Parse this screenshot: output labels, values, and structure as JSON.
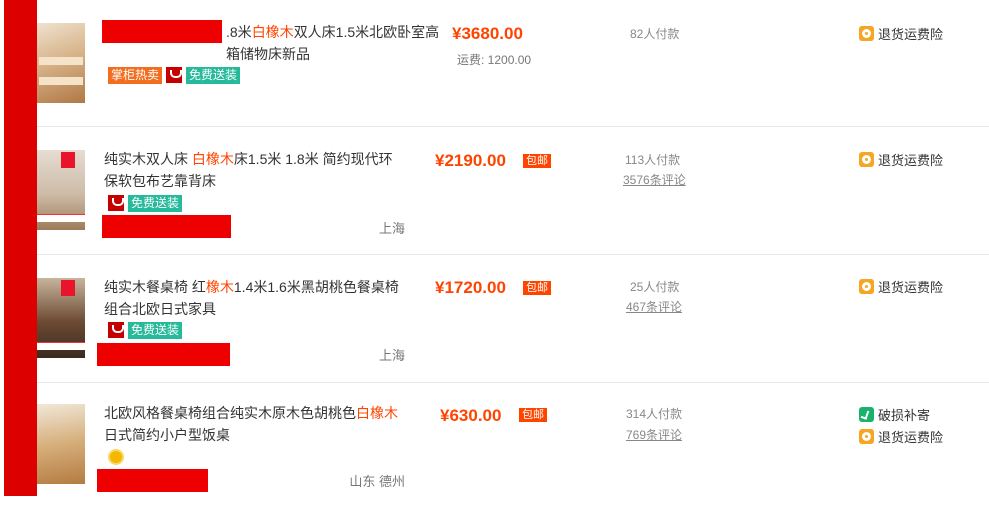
{
  "items": [
    {
      "title_kw": "白橡木",
      "title_pre": ".8米",
      "title_post": "双人床1.5米北欧卧室高箱储物床新品",
      "tags": [
        "掌柜热卖",
        "免费送装"
      ],
      "price": "¥3680.00",
      "freight": "运费: 1200.00",
      "sales": "82人付款",
      "service": "退货运费险"
    },
    {
      "title_pre": "纯实木双人床 ",
      "title_kw": "白橡木",
      "title_post": "床1.5米 1.8米 简约现代环保软包布艺靠背床",
      "tags": [
        "免费送装"
      ],
      "location": "上海",
      "price": "¥2190.00",
      "baoyou": "包邮",
      "sales": "113人付款",
      "reviews": "3576条评论",
      "service": "退货运费险"
    },
    {
      "title_pre": "纯实木餐桌椅 红",
      "title_kw": "橡木",
      "title_post": "1.4米1.6米黑胡桃色餐桌椅组合北欧日式家具",
      "tags": [
        "免费送装"
      ],
      "location": "上海",
      "price": "¥1720.00",
      "baoyou": "包邮",
      "sales": "25人付款",
      "reviews": "467条评论",
      "service": "退货运费险"
    },
    {
      "title_pre": "北欧风格餐桌椅组合纯实木原木色胡桃色",
      "title_kw": "白橡木",
      "title_post": "日式简约小户型饭桌",
      "location": "山东 德州",
      "price": "¥630.00",
      "baoyou": "包邮",
      "sales": "314人付款",
      "reviews": "769条评论",
      "service_damage": "破损补寄",
      "service": "退货运费险"
    }
  ]
}
